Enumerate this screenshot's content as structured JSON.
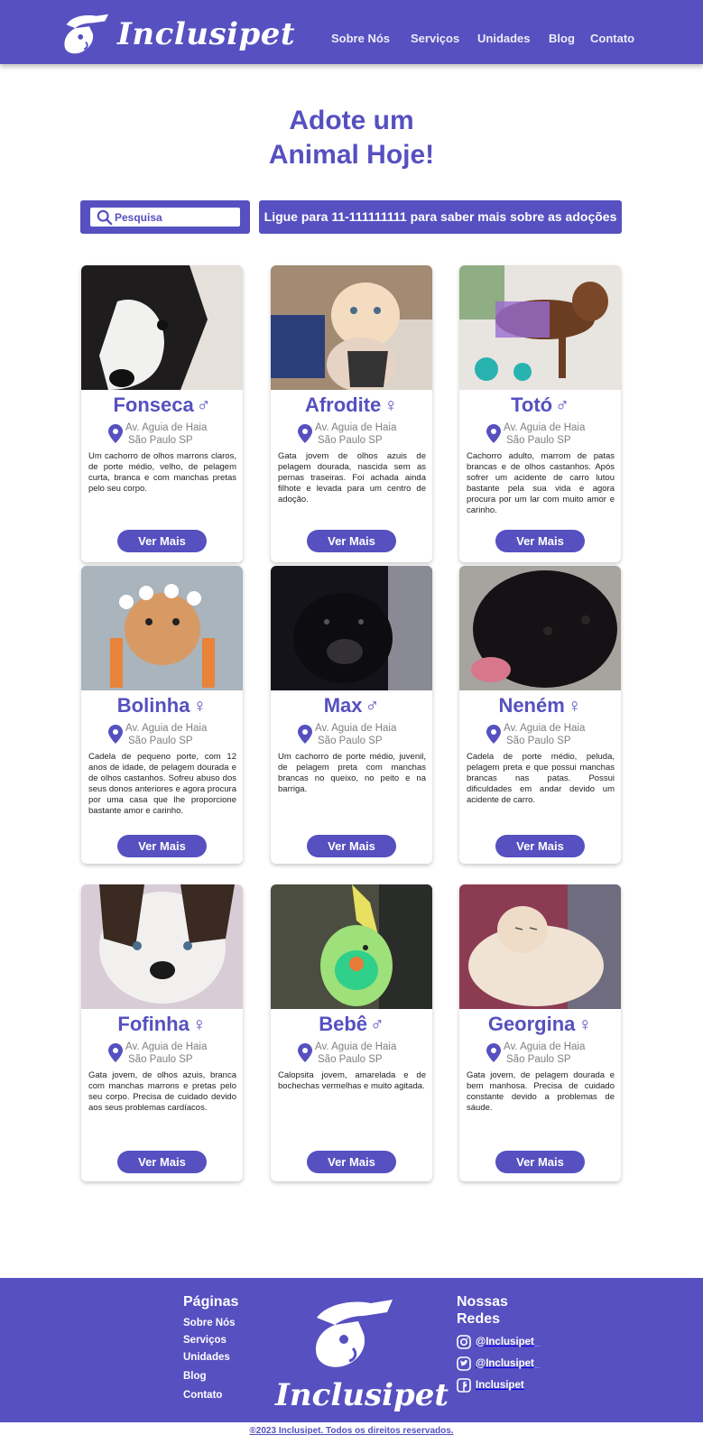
{
  "brand": {
    "name": "Inclusipet"
  },
  "nav": [
    "Sobre Nós",
    "Serviços",
    "Unidades",
    "Blog",
    "Contato"
  ],
  "hero": {
    "title_line1": "Adote um",
    "title_line2": "Animal Hoje!"
  },
  "search": {
    "placeholder": "Pesquisa"
  },
  "phone_banner": "Ligue para 11-111111111 para saber mais sobre as adoções",
  "button_label": "Ver Mais",
  "pets": [
    {
      "name": "Fonseca",
      "sex": "♂",
      "addr1": "Av. Aguia de Haia",
      "addr2": "São Paulo SP",
      "desc": "Um cachorro de olhos marrons claros, de porte médio, velho, de pelagem curta, branca e com manchas pretas pelo seu corpo."
    },
    {
      "name": "Afrodite",
      "sex": "♀",
      "addr1": "Av. Aguia de Haia",
      "addr2": "São Paulo SP",
      "desc": "Gata jovem de olhos azuis de pelagem dourada, nascida sem as pernas traseiras. Foi achada ainda filhote e levada para um centro de adoção."
    },
    {
      "name": "Totó",
      "sex": "♂",
      "addr1": "Av. Aguia de Haia",
      "addr2": "São Paulo SP",
      "desc": "Cachorro adulto, marrom de patas brancas e de olhos castanhos. Após sofrer um acidente de carro lutou bastante pela sua vida e agora procura por um lar com muito amor e carinho."
    },
    {
      "name": "Bolinha",
      "sex": "♀",
      "addr1": "Av. Aguia de Haia",
      "addr2": "São Paulo SP",
      "desc": "Cadela de pequeno porte, com 12 anos de idade, de pelagem dourada e de olhos castanhos. Sofreu abuso dos seus donos anteriores e agora procura por uma casa que lhe proporcione bastante amor e carinho."
    },
    {
      "name": "Max",
      "sex": "♂",
      "addr1": "Av. Aguia de Haia",
      "addr2": "São Paulo SP",
      "desc": "Um cachorro de porte médio, juvenil, de pelagem preta com manchas brancas no queixo, no peito e na barriga."
    },
    {
      "name": "Neném",
      "sex": "♀",
      "addr1": "Av. Aguia de Haia",
      "addr2": "São Paulo SP",
      "desc": "Cadela de porte médio, peluda, pelagem preta e que possui manchas brancas nas patas. Possui dificuldades em andar devido um acidente de carro."
    },
    {
      "name": "Fofinha",
      "sex": "♀",
      "addr1": "Av. Aguia de Haia",
      "addr2": "São Paulo SP",
      "desc": "Gata jovem, de olhos azuis, branca com manchas marrons e pretas pelo seu corpo. Precisa de cuidado devido aos seus problemas cardíacos."
    },
    {
      "name": "Bebê",
      "sex": "♂",
      "addr1": "Av. Aguia de Haia",
      "addr2": "São Paulo SP",
      "desc": "Calopsita jovem, amarelada e de bochechas vermelhas e muito agitada."
    },
    {
      "name": "Georgina",
      "sex": "♀",
      "addr1": "Av. Aguia de Haia",
      "addr2": "São Paulo SP",
      "desc": "Gata jovem, de pelagem dourada e bem manhosa. Precisa de cuidado constante devido a problemas de sáude."
    }
  ],
  "footer": {
    "pages_title": "Páginas",
    "pages": [
      "Sobre Nós",
      "Serviços",
      "Unidades",
      "Blog",
      "Contato"
    ],
    "social_title_line1": "Nossas",
    "social_title_line2": "Redes",
    "instagram": "@Inclusipet_",
    "twitter": "@Inclusipet_",
    "facebook": "Inclusipet",
    "copyright": "®2023 Inclusipet. Todos os direitos reservados."
  },
  "colors": {
    "primary": "#5650c0",
    "white": "#ffffff",
    "muted_text": "#808080"
  }
}
